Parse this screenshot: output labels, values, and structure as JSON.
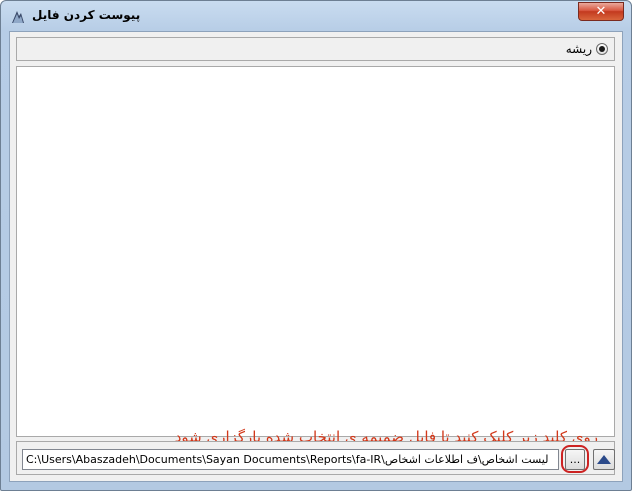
{
  "window": {
    "title": "پیوست کردن فایل",
    "close_glyph": "✕"
  },
  "radio_panel": {
    "option_label": "ریشه",
    "selected": true
  },
  "instruction_text": "روی کلید زیر کلیک کنید تا فایل ضمیمه ی انتخاب شده بارگزاری شود",
  "bottom_bar": {
    "path_value": "C:\\Users\\Abaszadeh\\Documents\\Sayan Documents\\Reports\\fa-IR\\لیست اشخاص\\ف اطلاعات اشخاص",
    "browse_label": "...",
    "up_icon": "triangle-up-icon"
  },
  "colors": {
    "instruction": "#d2381a",
    "highlight": "#cc2222",
    "close_button": "#c3391f"
  }
}
